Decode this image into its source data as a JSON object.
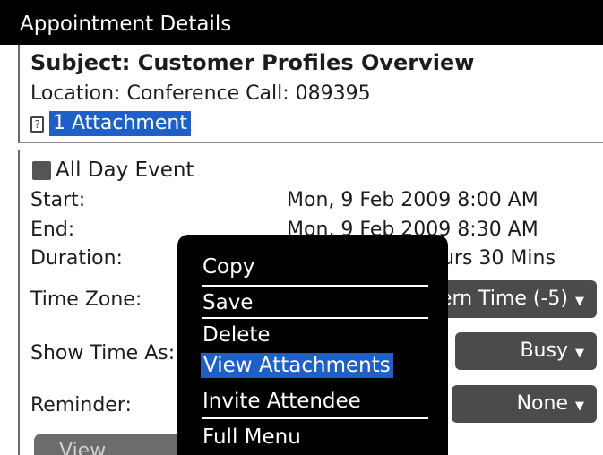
{
  "window": {
    "title": "Appointment Details"
  },
  "header": {
    "subject": "Subject: Customer Profiles Overview",
    "location": "Location: Conference Call: 089395",
    "attachment_link": "1 Attachment",
    "attachment_icon": "?"
  },
  "details": {
    "all_day_label": "All Day Event",
    "all_day_checked": true,
    "start_label": "Start:",
    "start_value": "Mon, 9 Feb 2009 8:00 AM",
    "end_label": "End:",
    "end_value": "Mon, 9 Feb 2009 8:30 AM",
    "duration_label": "Duration:",
    "duration_value": "0 Hours 30 Mins",
    "timezone_label": "Time Zone:",
    "timezone_value": "Eastern Time (-5)",
    "show_time_label": "Show Time As:",
    "show_time_value": "Busy",
    "reminder_label": "Reminder:",
    "reminder_value": "None",
    "view_button": "View Availability"
  },
  "context_menu": {
    "items": [
      {
        "label": "Copy"
      },
      {
        "label": "Save"
      },
      {
        "label": "Delete"
      },
      {
        "label": "View Attachments",
        "selected": true
      },
      {
        "label": "Invite Attendee"
      },
      {
        "label": "Full Menu"
      }
    ]
  },
  "colors": {
    "selection": "#1e5fc8",
    "titlebar": "#000000",
    "dropdown": "#4b4b4b"
  }
}
